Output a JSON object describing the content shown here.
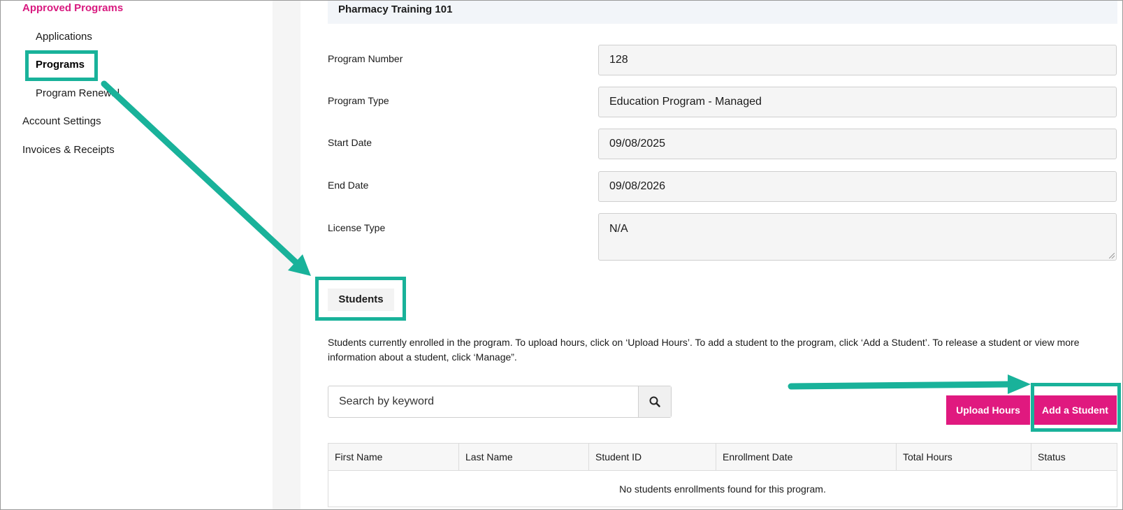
{
  "sidebar": {
    "section_title": "Approved Programs",
    "items": [
      {
        "label": "Applications"
      },
      {
        "label": "Programs"
      },
      {
        "label": "Program Renewal"
      },
      {
        "label": "Account Settings"
      },
      {
        "label": "Invoices & Receipts"
      }
    ]
  },
  "main": {
    "title": "Pharmacy Training 101",
    "fields": [
      {
        "label": "Program Number",
        "value": "128"
      },
      {
        "label": "Program Type",
        "value": "Education Program - Managed"
      },
      {
        "label": "Start Date",
        "value": "09/08/2025"
      },
      {
        "label": "End Date",
        "value": "09/08/2026"
      },
      {
        "label": "License Type",
        "value": "N/A"
      }
    ],
    "students_tab": "Students",
    "description": "Students currently enrolled in the program. To upload hours, click on ‘Upload Hours’. To add a student to the program, click ‘Add a Student’. To release a student or view more information about a student, click ‘Manage”.",
    "search": {
      "placeholder": "Search by keyword",
      "icon": "search-icon"
    },
    "buttons": {
      "upload_hours": "Upload Hours",
      "add_student": "Add a Student"
    },
    "table": {
      "headers": [
        "First Name",
        "Last Name",
        "Student ID",
        "Enrollment Date",
        "Total Hours",
        "Status"
      ],
      "empty_message": "No students enrollments found for this program."
    }
  },
  "colors": {
    "accent": "#e0197f",
    "annotation": "#19b29a"
  }
}
